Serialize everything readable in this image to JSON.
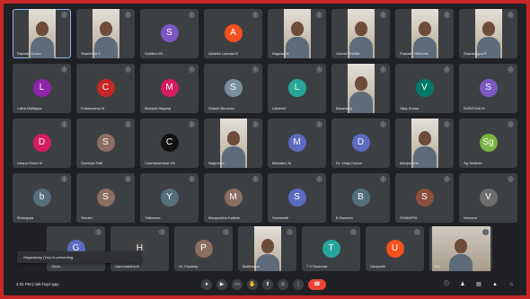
{
  "meeting": {
    "time_code": "4:31 PM | nek-huyz-gqo",
    "toast": "Gagandeep (You) is presenting"
  },
  "participants": [
    {
      "name": "Ramesh Kuma",
      "type": "video",
      "color": "#8ab4f8"
    },
    {
      "name": "Shanthala S",
      "type": "video",
      "color": "#8ab4f8"
    },
    {
      "name": "Sunitha HD",
      "type": "avatar",
      "initial": "S",
      "color": "#7e57c2"
    },
    {
      "name": "Ashwini Laxman B",
      "type": "avatar",
      "initial": "A",
      "color": "#f4511e"
    },
    {
      "name": "Nagaraj M",
      "type": "video",
      "color": "#8ab4f8"
    },
    {
      "name": "Umesh Shettar",
      "type": "video",
      "color": "#8ab4f8"
    },
    {
      "name": "Prakash Hiremath",
      "type": "video",
      "color": "#8ab4f8"
    },
    {
      "name": "Sharanappa R",
      "type": "video",
      "color": "#8ab4f8"
    },
    {
      "name": "Latha Mallappa",
      "type": "avatar",
      "initial": "L",
      "color": "#8e24aa"
    },
    {
      "name": "Puttaswamy M",
      "type": "avatar",
      "initial": "C",
      "color": "#c62828"
    },
    {
      "name": "Manjula Nagaraj",
      "type": "avatar",
      "initial": "M",
      "color": "#d81b60"
    },
    {
      "name": "Shashi Bhushan",
      "type": "avatar",
      "initial": "S",
      "color": "#78909c"
    },
    {
      "name": "Lakshmi",
      "type": "avatar",
      "initial": "L",
      "color": "#26a69a"
    },
    {
      "name": "Basavaraj",
      "type": "video",
      "color": "#8ab4f8"
    },
    {
      "name": "Vijay Kumar",
      "type": "avatar",
      "initial": "V",
      "color": "#00796b"
    },
    {
      "name": "SURESHA M",
      "type": "avatar",
      "initial": "S",
      "color": "#7e57c2"
    },
    {
      "name": "Deepa Shree M",
      "type": "avatar",
      "initial": "D",
      "color": "#d81b60"
    },
    {
      "name": "Sowmya Patil",
      "type": "avatar",
      "initial": "S",
      "color": "#8d6e63"
    },
    {
      "name": "Chandrashekar HS",
      "type": "avatar",
      "initial": "C",
      "color": "#111111"
    },
    {
      "name": "Nagendra",
      "type": "video",
      "color": "#8ab4f8"
    },
    {
      "name": "Mahadev M",
      "type": "avatar",
      "initial": "M",
      "color": "#5c6bc0"
    },
    {
      "name": "Dr. Vinay Kumar",
      "type": "avatar",
      "initial": "D",
      "color": "#5c6bc0"
    },
    {
      "name": "Manjunatha",
      "type": "video",
      "color": "#8ab4f8"
    },
    {
      "name": "Sg Siddesh",
      "type": "avatar",
      "initial": "Sg",
      "color": "#7cb342"
    },
    {
      "name": "Bhimappa",
      "type": "avatar",
      "initial": "b",
      "color": "#546e7a"
    },
    {
      "name": "Shruthi",
      "type": "avatar",
      "initial": "S",
      "color": "#8d6e63"
    },
    {
      "name": "Yallamma",
      "type": "avatar",
      "initial": "Y",
      "color": "#546e7a"
    },
    {
      "name": "Manjunatha Kallesh",
      "type": "avatar",
      "initial": "M",
      "color": "#8d6e63"
    },
    {
      "name": "Sreekanth",
      "type": "avatar",
      "initial": "S",
      "color": "#5c6bc0"
    },
    {
      "name": "B Ramesh",
      "type": "avatar",
      "initial": "B",
      "color": "#546e7a"
    },
    {
      "name": "SOMAPPA",
      "type": "avatar",
      "initial": "S",
      "color": "#8d4e3e"
    },
    {
      "name": "Veerana",
      "type": "avatar",
      "initial": "V",
      "color": "#6d6d6d"
    }
  ],
  "strip": [
    {
      "name": "Girish",
      "type": "avatar",
      "initial": "G",
      "color": "#5c6bc0"
    },
    {
      "name": "Hanumantha B",
      "type": "avatar",
      "initial": "H",
      "color": "#424242"
    },
    {
      "name": "Dr. Pradeep",
      "type": "avatar",
      "initial": "P",
      "color": "#8d6e63"
    },
    {
      "name": "Mallikarjun",
      "type": "video",
      "color": "#8ab4f8"
    },
    {
      "name": "T V Ravindra",
      "type": "avatar",
      "initial": "T",
      "color": "#26a69a"
    },
    {
      "name": "Umapathi",
      "type": "avatar",
      "initial": "U",
      "color": "#f4511e"
    },
    {
      "name": "You",
      "type": "video-wide",
      "color": "#8ab4f8"
    }
  ],
  "controls": [
    "mic",
    "camera",
    "captions",
    "raise-hand",
    "present",
    "more"
  ],
  "right_controls": [
    "info",
    "people",
    "chat",
    "activities",
    "lock"
  ]
}
